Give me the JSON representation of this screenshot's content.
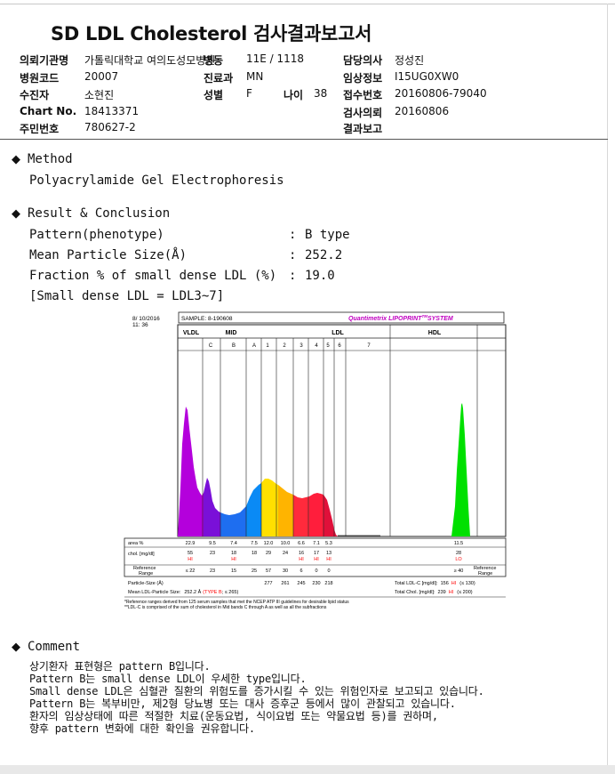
{
  "title": "SD LDL Cholesterol 검사결과보고서",
  "header": {
    "institution_label": "의뢰기관명",
    "institution": "가톨릭대학교 여의도성모병원",
    "ward_label": "병동",
    "ward": "11E / 1118",
    "doctor_label": "담당의사",
    "doctor": "정성진",
    "hospital_code_label": "병원코드",
    "hospital_code": "20007",
    "dept_label": "진료과",
    "dept": "MN",
    "clinical_label": "임상정보",
    "clinical": "I15UG0XW0",
    "examinee_label": "수진자",
    "examinee": "소현진",
    "sex_label": "성별",
    "sex": "F",
    "age_label": "나이",
    "age": "38",
    "reception_label": "접수번호",
    "reception": "20160806-79040",
    "chart_label": "Chart No.",
    "chart": "18413371",
    "request_label": "검사의뢰",
    "request": "20160806",
    "id_label": "주민번호",
    "id": "780627-2",
    "report_label": "결과보고",
    "report": ""
  },
  "method": {
    "heading": "Method",
    "text": "Polyacrylamide Gel Electrophoresis"
  },
  "result": {
    "heading": "Result & Conclusion",
    "rows": [
      {
        "label": "Pattern(phenotype)",
        "colon": ":",
        "value": "B type"
      },
      {
        "label": "Mean Particle Size(Å)",
        "colon": ":",
        "value": "252.2"
      },
      {
        "label": "Fraction % of small dense LDL (%)",
        "colon": ":",
        "value": "19.0"
      }
    ],
    "note": "[Small dense LDL = LDL3~7]"
  },
  "chart": {
    "date": "8/ 10/2016",
    "time": "11: 36",
    "sample": "SAMPLE:   8-190608",
    "brand": "Quantimetrix LIPOPRINT",
    "brand_tm": "TM",
    "brand_sys": "SYSTEM",
    "groups": [
      "VLDL",
      "MID",
      "LDL",
      "HDL"
    ],
    "bands": [
      "C",
      "B",
      "A",
      "1",
      "2",
      "3",
      "4",
      "5",
      "6",
      "7"
    ],
    "row_area_label": "area %",
    "area": [
      "22.9",
      "9.5",
      "7.4",
      "7.5",
      "12.0",
      "10.0",
      "6.6",
      "7.1",
      "5.3",
      "",
      "11.5"
    ],
    "row_chol_label": "chol. [mg/dl]",
    "chol": [
      "55",
      "23",
      "18",
      "18",
      "29",
      "24",
      "16",
      "17",
      "13",
      "",
      "28"
    ],
    "flags": [
      "HI",
      "",
      "HI",
      "",
      "",
      "",
      "HI",
      "HI",
      "HI",
      "",
      "LO"
    ],
    "ref_label_1": "Reference",
    "ref_label_2": "Range",
    "ref": [
      "≤ 22",
      "23",
      "15",
      "25",
      "57",
      "30",
      "6",
      "0",
      "0",
      "",
      "≥ 40"
    ],
    "ref_right_1": "Reference",
    "ref_right_2": "Range",
    "ps_label": "Particle-Size (Å)",
    "ps": [
      "277",
      "261",
      "245",
      "230",
      "218"
    ],
    "mean_label": "Mean LDL-Particle Size:",
    "mean_value": "252.2 Å",
    "mean_type": "(TYPE B",
    "mean_ref": "; ≤ 265)",
    "total_ldl_label": "Total LDL-C [mg/dl]:",
    "total_ldl": "156",
    "total_ldl_flag": "HI",
    "total_ldl_ref": "(≤ 130)",
    "total_chol_label": "Total Chol. [mg/dl]:",
    "total_chol": "239",
    "total_chol_flag": "HI",
    "total_chol_ref": "(≤ 200)",
    "foot1": "*Reference ranges derived from 125 serum samples that met the NCEP ATP III guidelines for desirable lipid status",
    "foot2": "**LDL-C is comprised of the sum of cholesterol in Mid bands C through A as well as all the subfractions"
  },
  "colors": {
    "VLDL": "#b400dc",
    "C": "#6b00d8",
    "B": "#1e6ef0",
    "A": "#1e6ef0",
    "L1": "#ffd200",
    "L2": "#ffb400",
    "L3": "#ff1e3c",
    "L4": "#ff1e3c",
    "L5": "#e0103a",
    "HDL": "#00e000",
    "flag": "#ff0000",
    "brand": "#c000c0"
  },
  "comment": {
    "heading": "Comment",
    "lines": [
      "상기환자 표현형은 pattern B입니다.",
      "Pattern B는 small dense LDL이 우세한 type입니다.",
      "Small dense LDL은 심혈관 질환의 위험도를 증가시킬 수 있는 위험인자로 보고되고 있습니다.",
      "Pattern B는 복부비만, 제2형 당뇨병 또는 대사 증후군 등에서 많이 관찰되고 있습니다.",
      "환자의 임상상태에 따른 적절한 치료(운동요법, 식이요법 또는 약물요법 등)를 권하며,",
      "향후 pattern 변화에 대한 확인을 권유합니다."
    ]
  }
}
